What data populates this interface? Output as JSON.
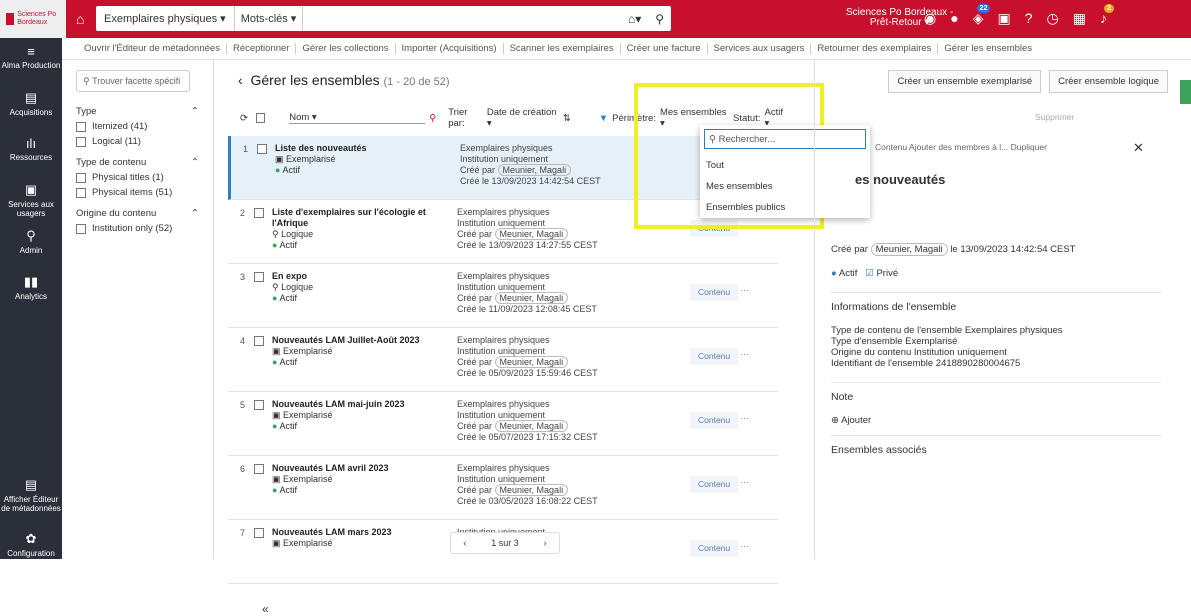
{
  "topbar": {
    "logo": "Sciences Po Bordeaux",
    "scope": "Exemplaires physiques ▾",
    "scope2": "Mots-clés ▾",
    "institution_line1": "Sciences Po Bordeaux -",
    "institution_line2": "Prêt-Retour ▾",
    "badge1": "22",
    "badge2": "2"
  },
  "leftnav": {
    "items": [
      {
        "icon": "≡",
        "label": "Alma Production"
      },
      {
        "icon": "▤",
        "label": "Acquisitions"
      },
      {
        "icon": "ılı",
        "label": "Ressources"
      },
      {
        "icon": "▣",
        "label": "Services aux usagers"
      },
      {
        "icon": "⚲",
        "label": "Admin"
      },
      {
        "icon": "▮▮",
        "label": "Analytics"
      }
    ],
    "bottom1": "Afficher Éditeur de métadonnées",
    "bottom2": "Configuration"
  },
  "menubar": [
    "Ouvrir l'Éditeur de métadonnées",
    "Réceptionner",
    "Gérer les collections",
    "Importer (Acquisitions)",
    "Scanner les exemplaires",
    "Créer une facture",
    "Services aux usagers",
    "Retourner des exemplaires",
    "Gérer les ensembles"
  ],
  "facets": {
    "search_placeholder": "Trouver facette spécifi",
    "groups": [
      {
        "title": "Type",
        "items": [
          "Itemized (41)",
          "Logical (11)"
        ]
      },
      {
        "title": "Type de contenu",
        "items": [
          "Physical titles (1)",
          "Physical items (51)"
        ]
      },
      {
        "title": "Origine du contenu",
        "items": [
          "Institution only (52)"
        ]
      }
    ]
  },
  "main": {
    "title": "Gérer les ensembles",
    "count": "(1 - 20 de 52)",
    "name_select": "Nom ▾",
    "sort_label": "Trier par:",
    "sort_value": "Date de création ▾",
    "perimetre_label": "Périmètre:",
    "perimetre_value": "Mes ensembles ▾",
    "statut_label": "Statut:",
    "statut_value": "Actif ▾"
  },
  "rows": [
    {
      "num": "1",
      "name": "Liste des nouveautés",
      "type": "Exemplarisé",
      "status": "Actif",
      "c1": "Exemplaires physiques",
      "c2": "Institution uniquement",
      "author": "Meunier, Magali",
      "date": "Créé le 13/09/2023 14:42:54 CEST"
    },
    {
      "num": "2",
      "name": "Liste d'exemplaires sur l'écologie et l'Afrique",
      "type": "Logique",
      "status": "Actif",
      "c1": "Exemplaires physiques",
      "c2": "Institution uniquement",
      "author": "Meunier, Magali",
      "date": "Créé le 13/09/2023 14:27:55 CEST"
    },
    {
      "num": "3",
      "name": "En expo",
      "type": "Logique",
      "status": "Actif",
      "c1": "Exemplaires physiques",
      "c2": "Institution uniquement",
      "author": "Meunier, Magali",
      "date": "Créé le 11/09/2023 12:08:45 CEST"
    },
    {
      "num": "4",
      "name": "Nouveautés LAM Juillet-Août 2023",
      "type": "Exemplarisé",
      "status": "Actif",
      "c1": "Exemplaires physiques",
      "c2": "Institution uniquement",
      "author": "Meunier, Magali",
      "date": "Créé le 05/09/2023 15:59:46 CEST"
    },
    {
      "num": "5",
      "name": "Nouveautés LAM mai-juin 2023",
      "type": "Exemplarisé",
      "status": "Actif",
      "c1": "Exemplaires physiques",
      "c2": "Institution uniquement",
      "author": "Meunier, Magali",
      "date": "Créé le 05/07/2023 17:15:32 CEST"
    },
    {
      "num": "6",
      "name": "Nouveautés LAM avril 2023",
      "type": "Exemplarisé",
      "status": "Actif",
      "c1": "Exemplaires physiques",
      "c2": "Institution uniquement",
      "author": "Meunier, Magali",
      "date": "Créé le 03/05/2023 16:08:22 CEST"
    },
    {
      "num": "7",
      "name": "Nouveautés LAM mars 2023",
      "type": "Exemplarisé",
      "status": "",
      "c1": "Institution uniquement",
      "c2": "",
      "author": "",
      "date": ""
    }
  ],
  "row_button": "Contenu",
  "pager": "1 sur 3",
  "dropdown": {
    "search": "Rechercher...",
    "options": [
      "Tout",
      "Mes ensembles",
      "Ensembles publics"
    ]
  },
  "right": {
    "btn1": "Créer un ensemble exemplarisé",
    "btn2": "Créer ensemble logique",
    "supprimer": "Supprimer",
    "tabs": "Contenu   Ajouter des membres à l...   Dupliquer",
    "title": "es nouveautés",
    "created": "Créé par",
    "author": "Meunier, Magali",
    "created_date": "le 13/09/2023 14:42:54 CEST",
    "actif": "Actif",
    "prive": "Privé",
    "info_title": "Informations de l'ensemble",
    "info": [
      "Type de contenu de l'ensemble Exemplaires physiques",
      "Type d'ensemble Exemplarisé",
      "Origine du contenu Institution uniquement",
      "Identifiant de l'ensemble 2418890280004675"
    ],
    "note": "Note",
    "ajouter": "Ajouter",
    "associes": "Ensembles associés"
  }
}
